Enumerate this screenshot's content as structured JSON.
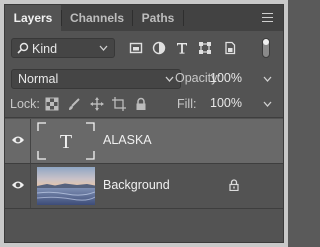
{
  "tabs": [
    {
      "label": "Layers",
      "active": true
    },
    {
      "label": "Channels",
      "active": false
    },
    {
      "label": "Paths",
      "active": false
    }
  ],
  "panel_menu_icon": "hamburger-menu-icon",
  "filter": {
    "kind_label": "Kind",
    "icons": [
      "pixel-filter-icon",
      "adjustment-filter-icon",
      "type-filter-icon",
      "shape-filter-icon",
      "smart-object-filter-icon"
    ]
  },
  "blend": {
    "mode": "Normal",
    "opacity_label": "Opacity:",
    "opacity_value": "100%"
  },
  "lock": {
    "label": "Lock:",
    "icons": [
      "lock-transparent-pixels-icon",
      "lock-image-pixels-icon",
      "lock-position-icon",
      "lock-artboard-icon",
      "lock-all-icon"
    ],
    "fill_label": "Fill:",
    "fill_value": "100%"
  },
  "layers": [
    {
      "name": "ALASKA",
      "type": "text",
      "selected": true,
      "thumb_glyph": "T",
      "locked": false
    },
    {
      "name": "Background",
      "type": "image",
      "selected": false,
      "locked": true
    }
  ],
  "colors": {
    "panel_bg": "#535353",
    "tabbar_bg": "#424242",
    "selected_row": "#696969"
  }
}
